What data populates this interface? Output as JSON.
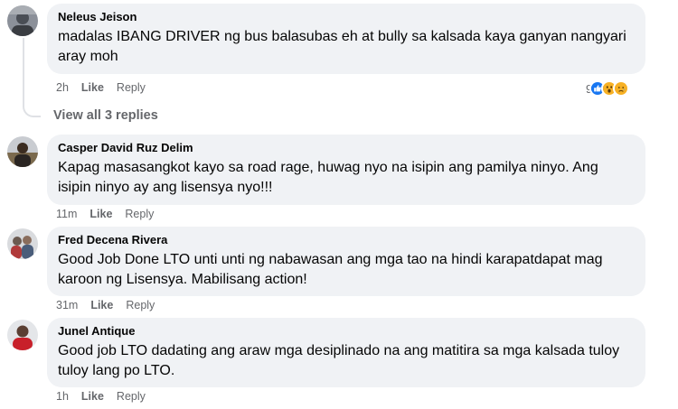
{
  "comments": [
    {
      "author": "Neleus Jeison",
      "text": "madalas IBANG DRIVER ng bus balasubas eh at bully sa kalsada kaya ganyan nangyari\naray moh",
      "time": "2h",
      "like_label": "Like",
      "reply_label": "Reply",
      "reaction_count": "9",
      "reaction_icons": [
        "like-icon",
        "wow-icon",
        "sad-icon"
      ]
    },
    {
      "author": "Casper David Ruz Delim",
      "text": "Kapag masasangkot kayo sa road rage, huwag nyo na isipin ang pamilya ninyo. Ang\nisipin ninyo ay ang lisensya nyo!!!",
      "time": "11m",
      "like_label": "Like",
      "reply_label": "Reply"
    },
    {
      "author": "Fred Decena Rivera",
      "text": "Good Job Done LTO unti unti ng nabawasan ang mga tao na hindi karapatdapat mag\nkaroon ng Lisensya. Mabilisang action!",
      "time": "31m",
      "like_label": "Like",
      "reply_label": "Reply"
    },
    {
      "author": "Junel Antique",
      "text": "Good job LTO dadating ang araw mga desiplinado na ang matitira sa mga kalsada tuloy\ntuloy lang po LTO.",
      "time": "1h",
      "like_label": "Like",
      "reply_label": "Reply"
    }
  ],
  "view_replies_label": "View all 3 replies",
  "colors": {
    "bubble": "#f0f2f5",
    "meta": "#65676b",
    "text": "#050505",
    "like_blue": "#1877f2",
    "reaction_yellow": "#f7b125"
  }
}
